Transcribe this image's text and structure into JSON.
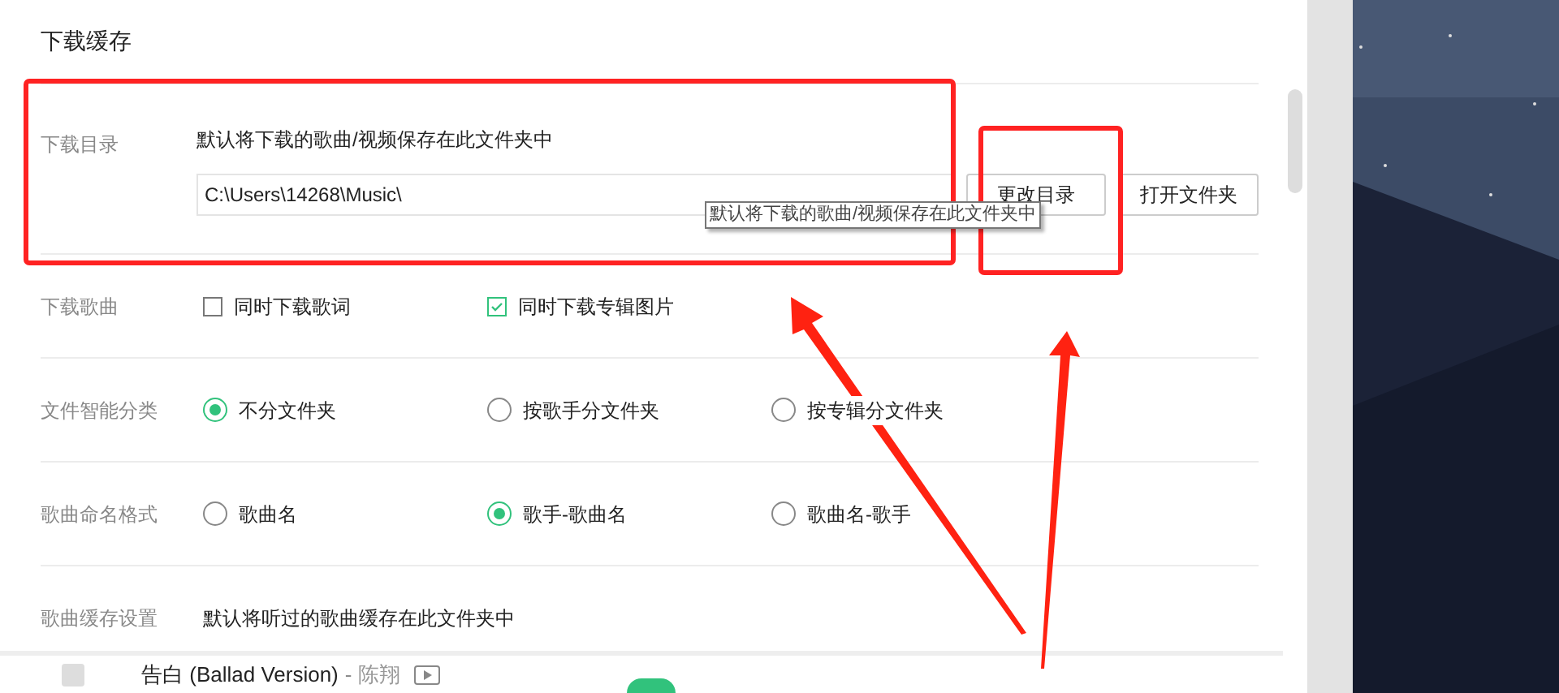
{
  "section_title": "下载缓存",
  "download_dir": {
    "label": "下载目录",
    "description": "默认将下载的歌曲/视频保存在此文件夹中",
    "path": "C:\\Users\\14268\\Music\\",
    "buttons": [
      "更改目录",
      "打开文件夹"
    ],
    "tooltip": "默认将下载的歌曲/视频保存在此文件夹中"
  },
  "download_songs": {
    "label": "下载歌曲",
    "options": [
      {
        "label": "同时下载歌词",
        "checked": false
      },
      {
        "label": "同时下载专辑图片",
        "checked": true
      }
    ]
  },
  "file_sort": {
    "label": "文件智能分类",
    "options": [
      {
        "label": "不分文件夹",
        "selected": true
      },
      {
        "label": "按歌手分文件夹",
        "selected": false
      },
      {
        "label": "按专辑分文件夹",
        "selected": false
      }
    ]
  },
  "naming": {
    "label": "歌曲命名格式",
    "options": [
      {
        "label": "歌曲名",
        "selected": false
      },
      {
        "label": "歌手-歌曲名",
        "selected": true
      },
      {
        "label": "歌曲名-歌手",
        "selected": false
      }
    ]
  },
  "cache": {
    "label": "歌曲缓存设置",
    "description": "默认将听过的歌曲缓存在此文件夹中"
  },
  "player": {
    "song": "告白 (Ballad Version)",
    "separator": "-",
    "artist": "陈翔"
  }
}
